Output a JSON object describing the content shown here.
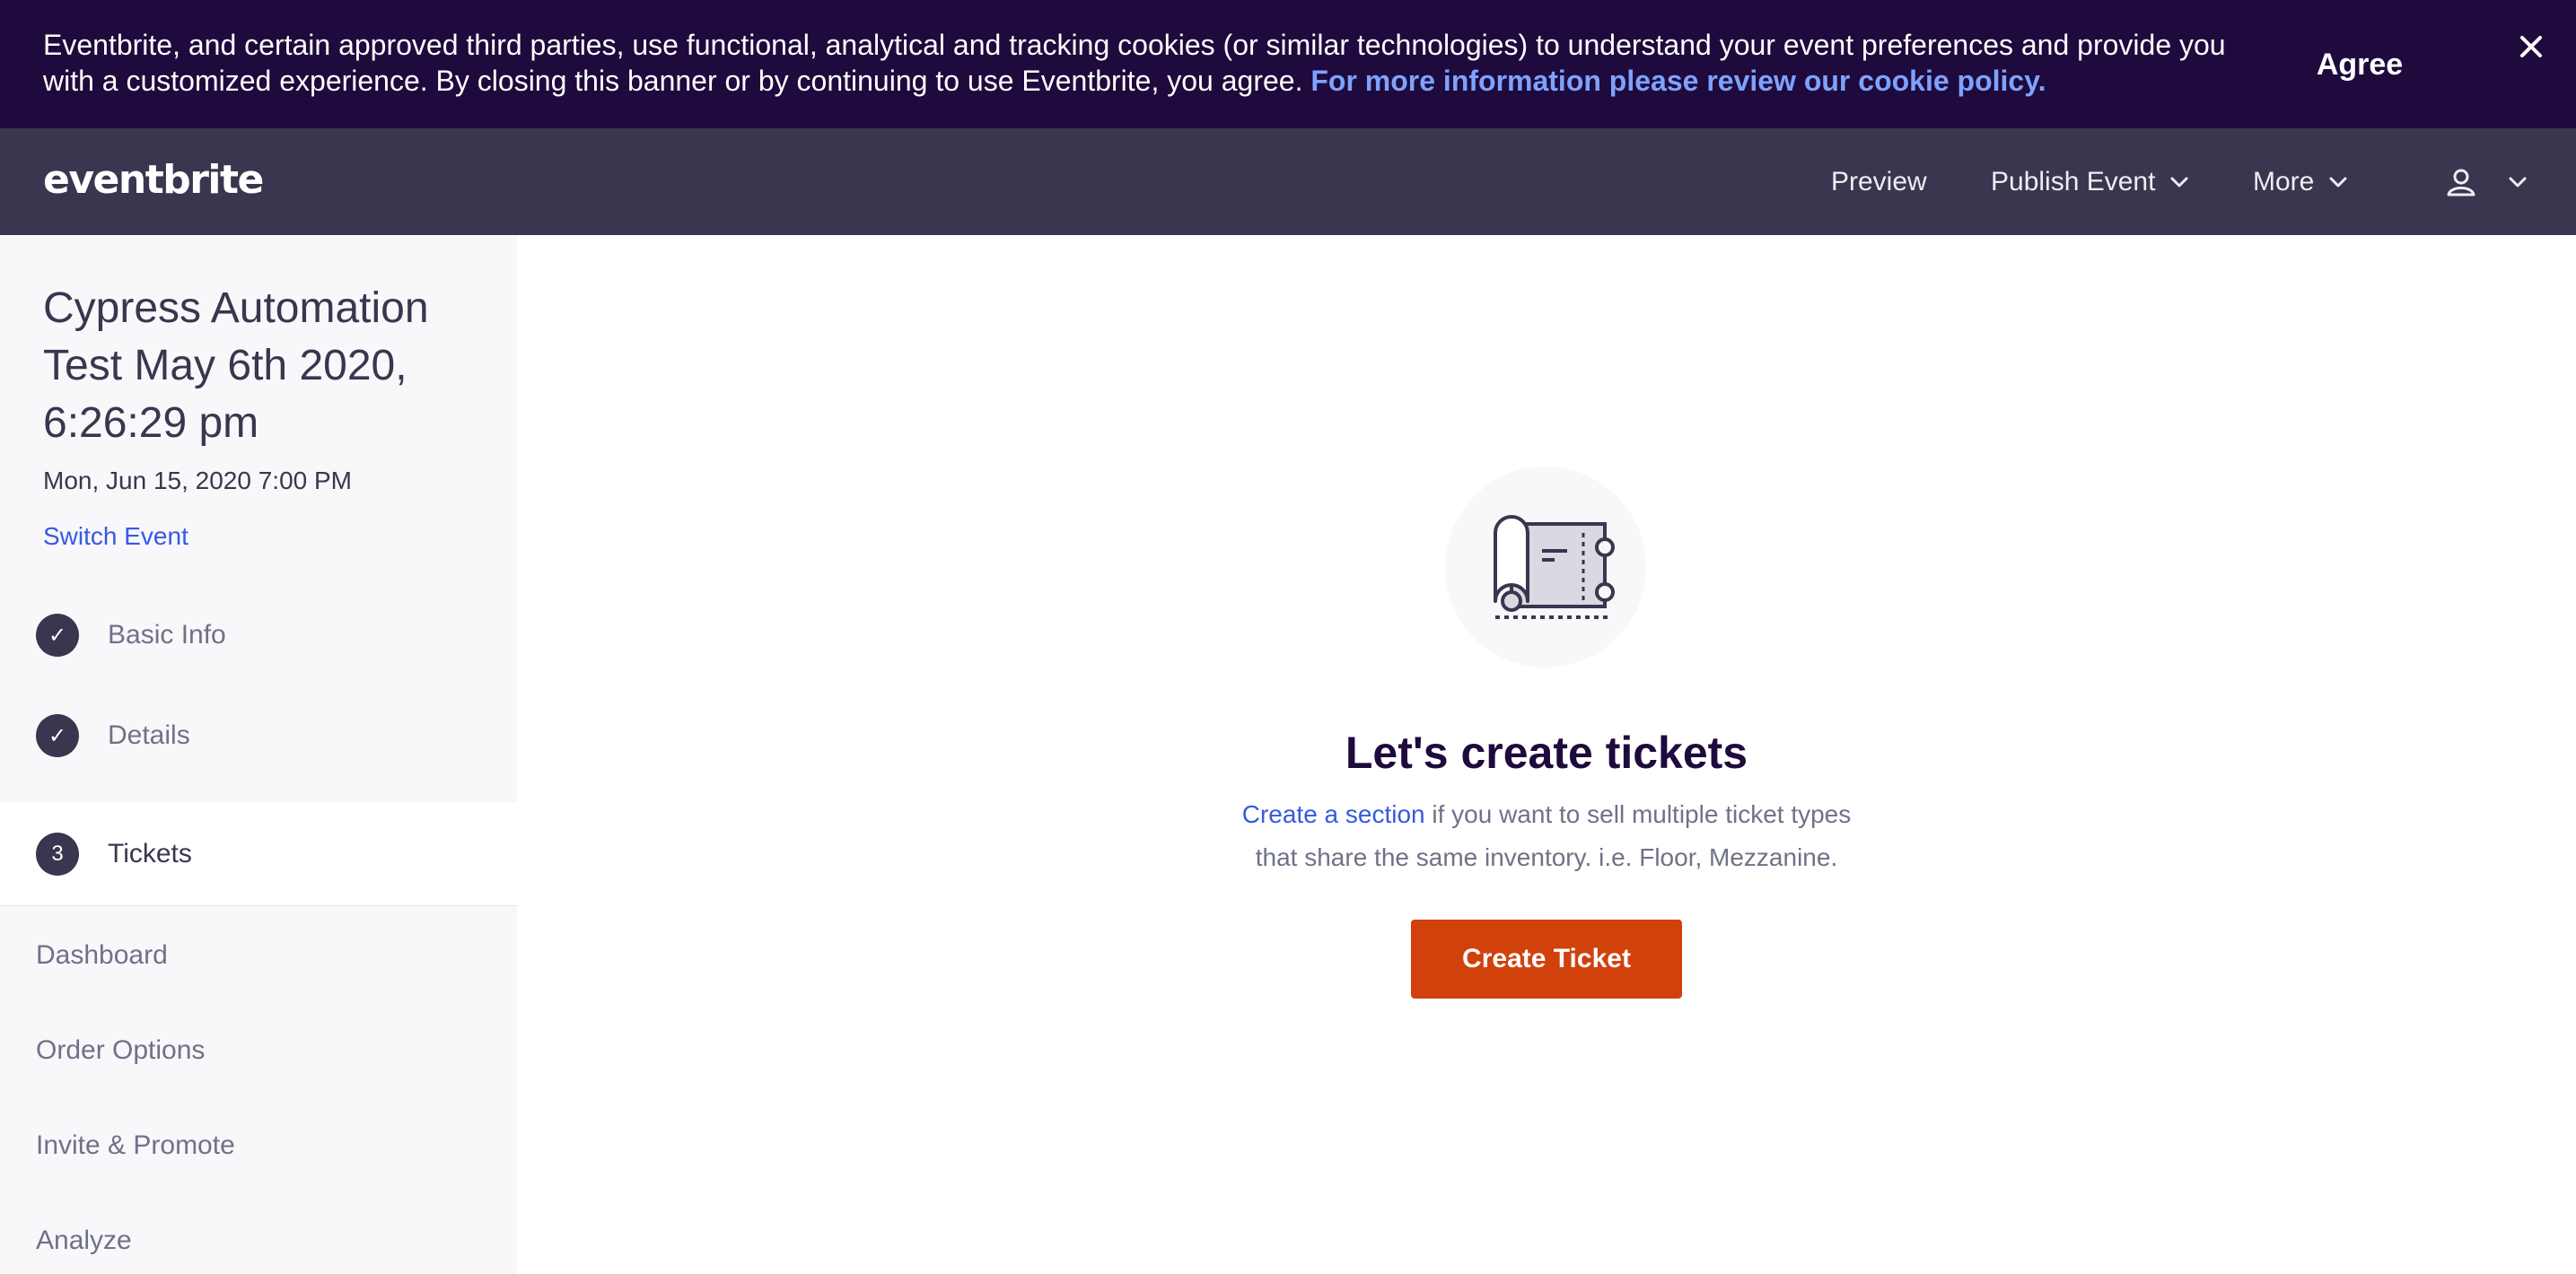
{
  "cookie_banner": {
    "text": "Eventbrite, and certain approved third parties, use functional, analytical and tracking cookies (or similar technologies) to understand your event preferences and provide you with a customized experience. By closing this banner or by continuing to use Eventbrite, you agree.",
    "link_text": "For more information please review our cookie policy.",
    "agree_label": "Agree",
    "close_icon": "close-icon"
  },
  "header": {
    "logo_text": "eventbrite",
    "nav": {
      "preview": "Preview",
      "publish_event": "Publish Event",
      "more": "More"
    },
    "icons": [
      "chevron-down-icon",
      "user-icon"
    ]
  },
  "sidebar": {
    "event_title": "Cypress Automation Test May 6th 2020, 6:26:29 pm",
    "event_date": "Mon, Jun 15, 2020 7:00 PM",
    "switch_event": "Switch Event",
    "steps": [
      {
        "label": "Basic Info",
        "marker": "✓",
        "state": "complete"
      },
      {
        "label": "Details",
        "marker": "✓",
        "state": "complete"
      },
      {
        "label": "Tickets",
        "marker": "3",
        "state": "active"
      }
    ],
    "links": [
      "Dashboard",
      "Order Options",
      "Invite & Promote",
      "Analyze"
    ]
  },
  "main": {
    "illustration": "ticket-icon",
    "title": "Let's create tickets",
    "desc_link": "Create a section",
    "desc_text_1": " if you want to sell multiple ticket types",
    "desc_text_2": "that share the same inventory. i.e. Floor, Mezzanine.",
    "create_button": "Create Ticket"
  },
  "colors": {
    "banner_bg": "#1e0a3c",
    "header_bg": "#39364f",
    "link_blue": "#3659e3",
    "cta_orange": "#d1410c",
    "sidebar_bg": "#f8f7fa"
  }
}
